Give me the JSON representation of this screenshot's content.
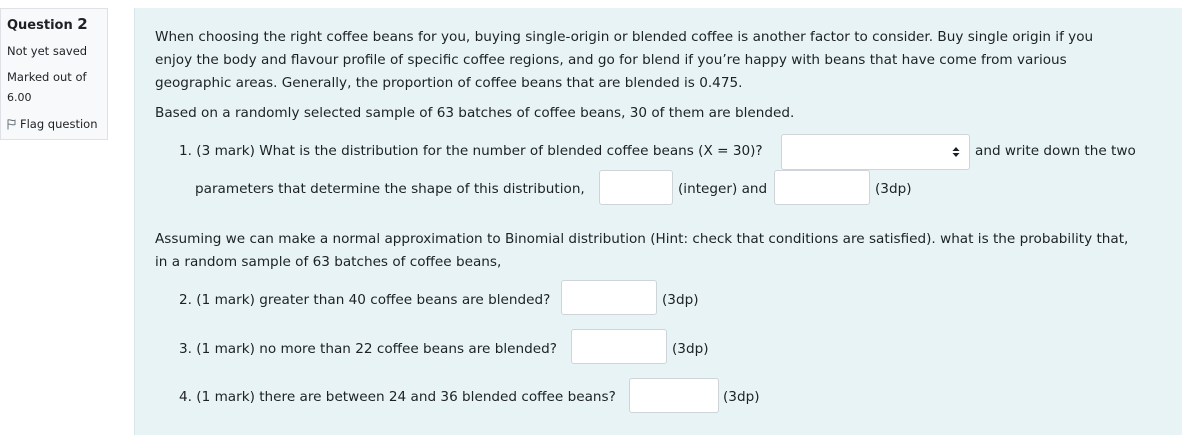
{
  "question_info": {
    "label": "Question",
    "number": "2",
    "state": "Not yet saved",
    "marked_label": "Marked out of",
    "marked_value": "6.00",
    "flag_label": "Flag question"
  },
  "content": {
    "intro_lines": [
      "When choosing the right coffee beans for you, buying single-origin or blended coffee is another factor to consider. Buy single origin if you",
      "enjoy the body and flavour profile of specific coffee regions, and go for blend if you’re happy with beans that have come from various",
      "geographic areas. Generally, the proportion of coffee beans that are blended is 0.475."
    ],
    "sample": "Based on a randomly selected sample of 63 batches of coffee beans, 30 of them are blended.",
    "q1": {
      "text": "1. (3 mark) What is the distribution for the number of blended coffee beans (X = 30)?",
      "dropdown_value": "",
      "after_dropdown": "and write down the two",
      "line2": "parameters that determine the shape of this distribution,",
      "param1_hint": "(integer) and",
      "param2_hint": "(3dp)",
      "param1_value": "",
      "param2_value": ""
    },
    "normal_lines": [
      "Assuming we can make a normal approximation to Binomial distribution (Hint: check that conditions are satisfied). what is the probability that,",
      "in a random sample of 63 batches of coffee beans,"
    ],
    "q2": {
      "text": "2. (1 mark) greater than 40 coffee beans are blended?",
      "hint": "(3dp)",
      "value": ""
    },
    "q3": {
      "text": "3. (1 mark) no more than 22 coffee beans are blended?",
      "hint": "(3dp)",
      "value": ""
    },
    "q4": {
      "text": "4. (1 mark) there are between 24 and 36 blended coffee beans?",
      "hint": "(3dp)",
      "value": ""
    }
  }
}
